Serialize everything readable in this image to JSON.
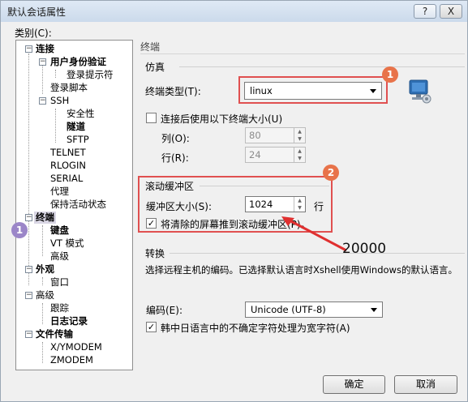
{
  "window": {
    "title": "默认会话属性",
    "help_label": "?",
    "close_label": "X"
  },
  "tree": {
    "label": "类别(C):",
    "toggles": {
      "minus": "−"
    },
    "items": [
      {
        "label": "连接"
      },
      {
        "label": "用户身份验证"
      },
      {
        "label": "登录提示符"
      },
      {
        "label": "登录脚本"
      },
      {
        "label": "SSH"
      },
      {
        "label": "安全性"
      },
      {
        "label": "隧道"
      },
      {
        "label": "SFTP"
      },
      {
        "label": "TELNET"
      },
      {
        "label": "RLOGIN"
      },
      {
        "label": "SERIAL"
      },
      {
        "label": "代理"
      },
      {
        "label": "保持活动状态"
      },
      {
        "label": "终端"
      },
      {
        "label": "键盘"
      },
      {
        "label": "VT 模式"
      },
      {
        "label": "高级"
      },
      {
        "label": "外观"
      },
      {
        "label": "窗口"
      },
      {
        "label": "高级"
      },
      {
        "label": "跟踪"
      },
      {
        "label": "日志记录"
      },
      {
        "label": "文件传输"
      },
      {
        "label": "X/YMODEM"
      },
      {
        "label": "ZMODEM"
      }
    ]
  },
  "section_title": "终端",
  "emulation": {
    "group_label": "仿真",
    "terminal_type_label": "终端类型(T):",
    "terminal_type_value": "linux",
    "resize_checkbox_label": "连接后使用以下终端大小(U)",
    "resize_checked": false,
    "cols_label": "列(O):",
    "cols_value": "80",
    "rows_label": "行(R):",
    "rows_value": "24"
  },
  "scroll": {
    "group_label": "滚动缓冲区",
    "size_label": "缓冲区大小(S):",
    "size_value": "1024",
    "unit": "行",
    "push_checkbox_label": "将清除的屏幕推到滚动缓冲区(P)。",
    "push_checked": true
  },
  "convert": {
    "group_label": "转换",
    "description": "选择远程主机的编码。已选择默认语言时Xshell使用Windows的默认语言。",
    "encoding_label": "编码(E):",
    "encoding_value": "Unicode (UTF-8)",
    "cjk_checkbox_label": "韩中日语言中的不确定字符处理为宽字符(A)",
    "cjk_checked": true
  },
  "buttons": {
    "ok": "确定",
    "cancel": "取消"
  },
  "annotations": {
    "badge1": "1",
    "badge2": "2",
    "badge_tree": "1",
    "note": "20000"
  },
  "colors": {
    "annotation_red": "#e05050",
    "badge_orange": "#e8734a",
    "badge_purple": "#9b86c8"
  },
  "icons": [
    "help-icon",
    "close-icon",
    "terminal-monitor-icon",
    "dropdown-arrow-icon",
    "spinner-arrows-icon",
    "checkbox-check-icon"
  ],
  "check_mark": "✓",
  "spin_up": "▲",
  "spin_down": "▼"
}
